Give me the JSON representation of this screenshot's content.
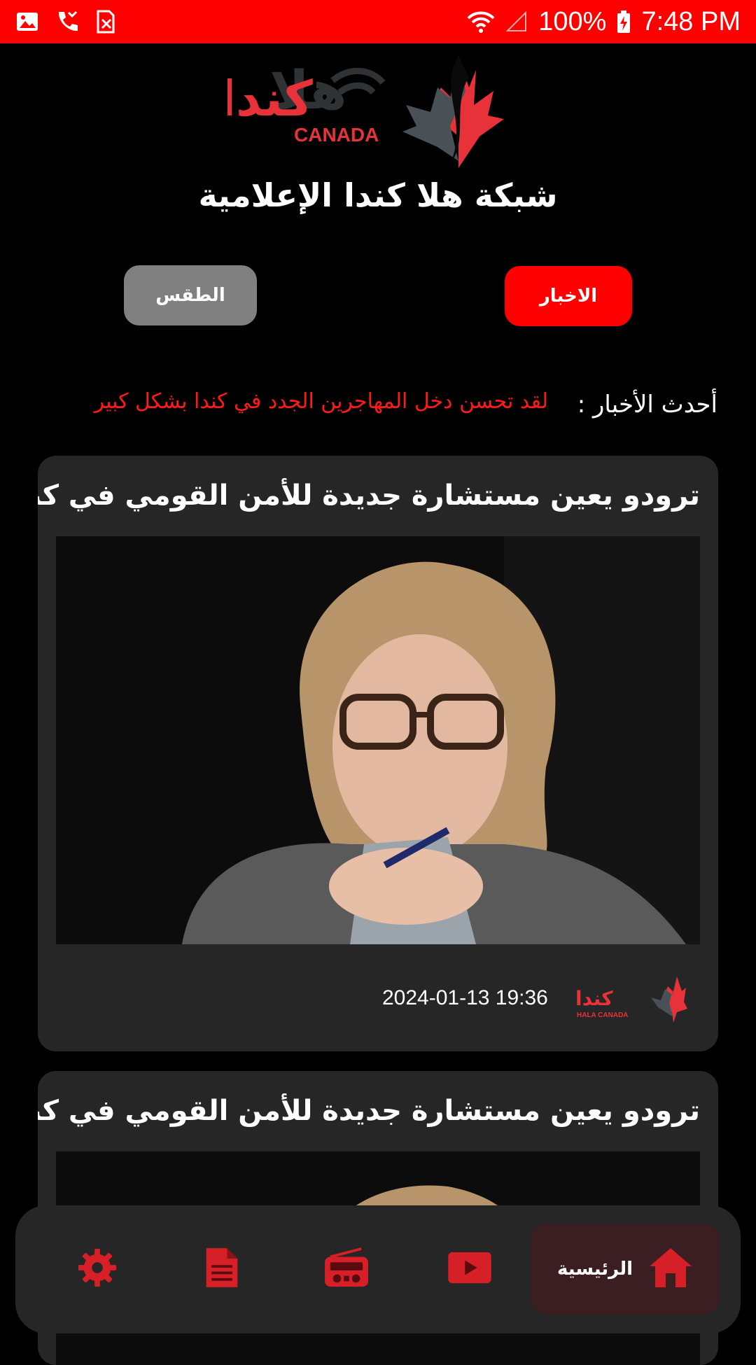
{
  "status_bar": {
    "battery": "100%",
    "time": "7:48 PM",
    "icons": [
      "image-icon",
      "missed-call-icon",
      "sim-off-icon",
      "wifi-icon",
      "signal-icon",
      "battery-charging-icon"
    ]
  },
  "header": {
    "logo_text": "كندا",
    "logo_subtext": "CANADA",
    "network_title": "شبكة هلا كندا الإعلامية"
  },
  "tabs": {
    "news_label": "الاخبار",
    "weather_label": "الطقس"
  },
  "ticker": {
    "label": "أحدث الأخبار :",
    "text": "لقد تحسن دخل المهاجرين الجدد في كندا بشكل كبير"
  },
  "articles": [
    {
      "title": "ترودو يعين مستشارة جديدة للأمن القومي في كندا",
      "datetime": "2024-01-13 19:36",
      "source_logo_text": "كندا",
      "source_logo_subtext": "HALA CANADA"
    },
    {
      "title": "ترودو يعين مستشارة جديدة للأمن القومي في كندا"
    }
  ],
  "bottom_nav": {
    "home_label": "الرئيسية",
    "items": [
      "settings-icon",
      "document-icon",
      "radio-icon",
      "youtube-icon",
      "home-icon"
    ]
  },
  "colors": {
    "accent": "#ff0000",
    "card_bg": "#262626",
    "nav_active_bg": "#3a1e22",
    "weather_button": "#808080"
  }
}
